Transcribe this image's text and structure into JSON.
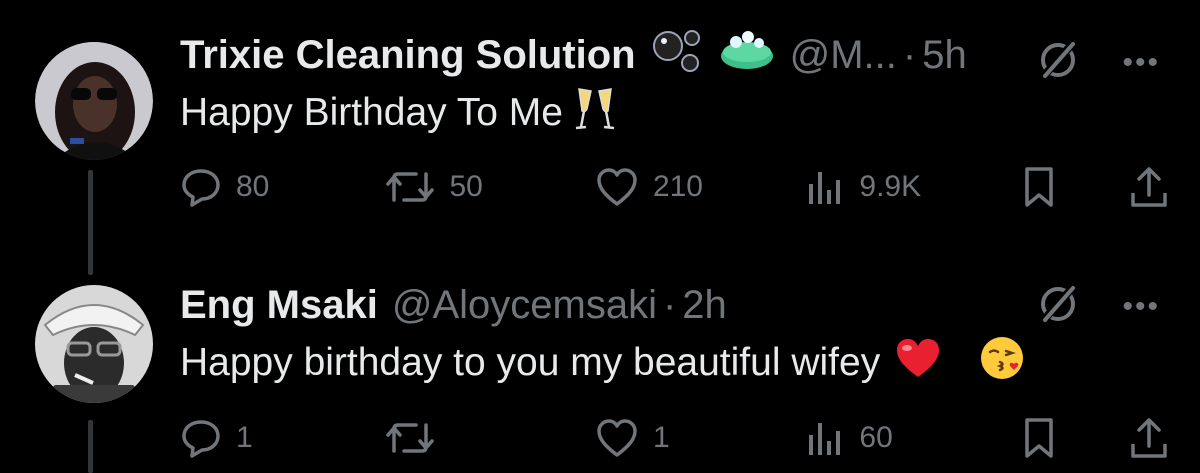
{
  "tweets": [
    {
      "author": "Trixie Cleaning Solution",
      "handle": "@M...",
      "separator": "·",
      "time": "5h",
      "badge_icons": [
        "bubbles-emoji-icon",
        "soap-emoji-icon"
      ],
      "text": "Happy Birthday To Me",
      "text_emojis": [
        "champagne-glasses-icon"
      ],
      "stats": {
        "replies": "80",
        "reposts": "50",
        "likes": "210",
        "views": "9.9K"
      }
    },
    {
      "author": "Eng Msaki",
      "handle": "@Aloycemsaki",
      "separator": "·",
      "time": "2h",
      "text": "Happy birthday to you my beautiful wifey",
      "text_emojis": [
        "red-heart-icon",
        "kissing-face-icon"
      ],
      "stats": {
        "replies": "1",
        "reposts": "",
        "likes": "1",
        "views": "60"
      }
    }
  ],
  "colors": {
    "background": "#000000",
    "text": "#e7e9ea",
    "muted": "#71767b",
    "thread_line": "#333639"
  }
}
